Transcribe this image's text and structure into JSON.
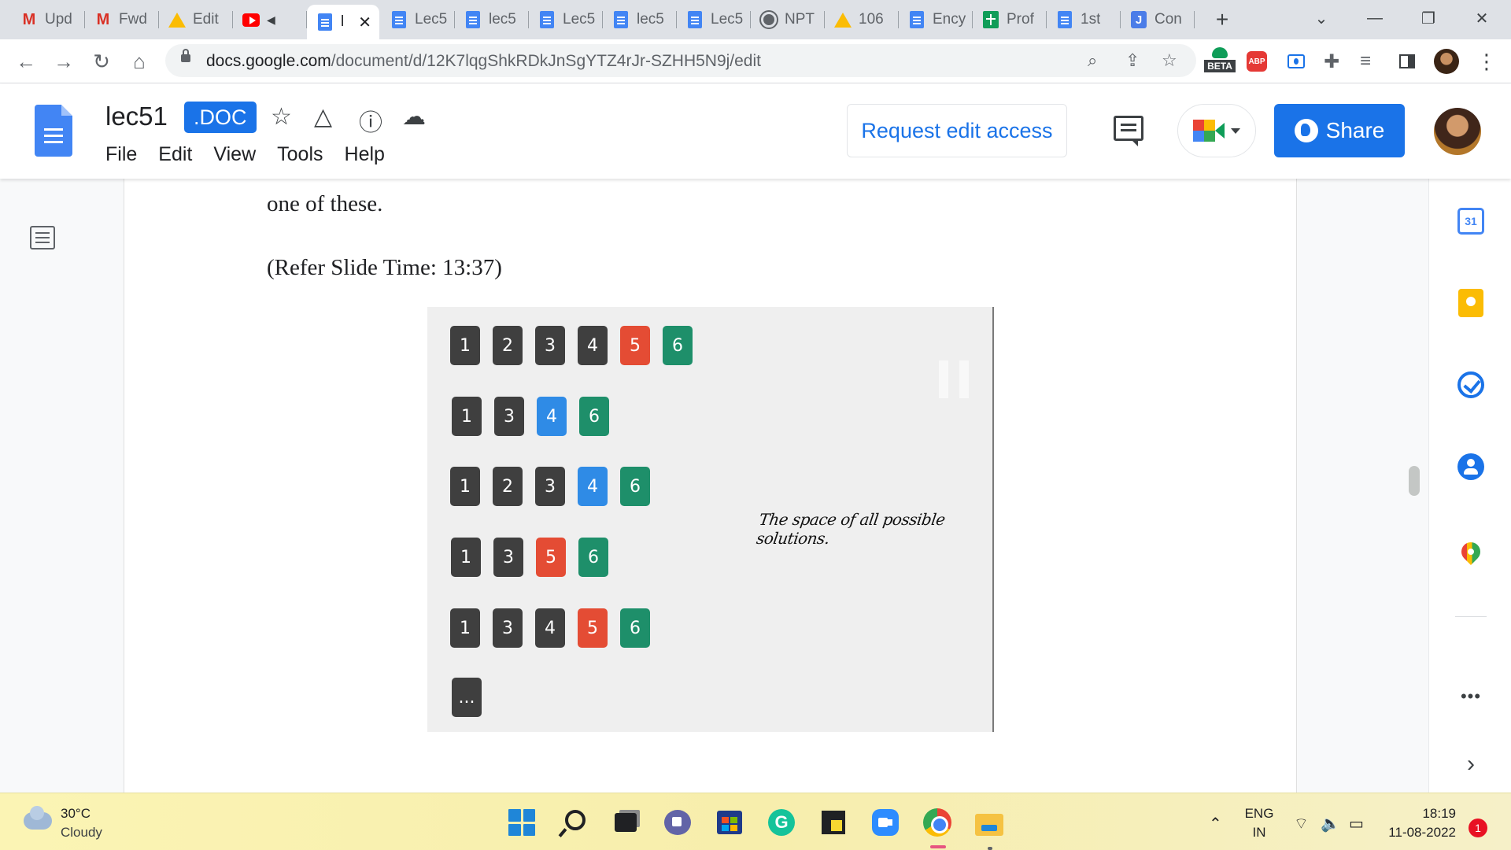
{
  "browser": {
    "tabs": [
      {
        "label": "Upd",
        "icon": "gmail"
      },
      {
        "label": "Fwd",
        "icon": "gmail"
      },
      {
        "label": "Edit",
        "icon": "drive"
      },
      {
        "label": "",
        "icon": "youtube"
      },
      {
        "label": "l",
        "icon": "docs",
        "active": true
      },
      {
        "label": "Lec5",
        "icon": "docs"
      },
      {
        "label": "lec5",
        "icon": "docs"
      },
      {
        "label": "Lec5",
        "icon": "docs"
      },
      {
        "label": "lec5",
        "icon": "docs"
      },
      {
        "label": "Lec5",
        "icon": "docs"
      },
      {
        "label": "NPT",
        "icon": "globe"
      },
      {
        "label": "106",
        "icon": "drive"
      },
      {
        "label": "Ency",
        "icon": "docs"
      },
      {
        "label": "Prof",
        "icon": "sheets"
      },
      {
        "label": "1st",
        "icon": "docs"
      },
      {
        "label": "Con",
        "icon": "j-app"
      }
    ],
    "url_host": "docs.google.com",
    "url_path": "/document/d/12K7lqgShkRDkJnSgYTZ4rJr-SZHH5N9j/edit",
    "beta_label": "BETA",
    "abp_label": "ABP"
  },
  "docs": {
    "title": "lec51",
    "badge": ".DOC",
    "menu": [
      "File",
      "Edit",
      "View",
      "Tools",
      "Help"
    ],
    "request_access": "Request edit access",
    "share_label": "Share"
  },
  "document": {
    "line1": "one of these.",
    "line2": "(Refer Slide Time: 13:37)"
  },
  "slide": {
    "caption": "The space of all possible solutions.",
    "colors": {
      "dark": "#3f3f3f",
      "red": "#e44c34",
      "green": "#1e8f6a",
      "blue": "#2f8be6"
    },
    "rows": [
      [
        {
          "t": "1",
          "c": "dark"
        },
        {
          "t": "2",
          "c": "dark"
        },
        {
          "t": "3",
          "c": "dark"
        },
        {
          "t": "4",
          "c": "dark"
        },
        {
          "t": "5",
          "c": "red"
        },
        {
          "t": "6",
          "c": "green"
        }
      ],
      [
        {
          "t": "1",
          "c": "dark"
        },
        {
          "t": "3",
          "c": "dark"
        },
        {
          "t": "4",
          "c": "blue"
        },
        {
          "t": "6",
          "c": "green"
        }
      ],
      [
        {
          "t": "1",
          "c": "dark"
        },
        {
          "t": "2",
          "c": "dark"
        },
        {
          "t": "3",
          "c": "dark"
        },
        {
          "t": "4",
          "c": "blue"
        },
        {
          "t": "6",
          "c": "green"
        }
      ],
      [
        {
          "t": "1",
          "c": "dark"
        },
        {
          "t": "3",
          "c": "dark"
        },
        {
          "t": "5",
          "c": "red"
        },
        {
          "t": "6",
          "c": "green"
        }
      ],
      [
        {
          "t": "1",
          "c": "dark"
        },
        {
          "t": "3",
          "c": "dark"
        },
        {
          "t": "4",
          "c": "dark"
        },
        {
          "t": "5",
          "c": "red"
        },
        {
          "t": "6",
          "c": "green"
        }
      ],
      [
        {
          "t": "...",
          "c": "dark"
        }
      ]
    ]
  },
  "sidebar": {
    "calendar_day": "31"
  },
  "taskbar": {
    "temperature": "30°C",
    "weather": "Cloudy",
    "lang_top": "ENG",
    "lang_bottom": "IN",
    "time": "18:19",
    "date": "11-08-2022",
    "notifications": "1"
  }
}
